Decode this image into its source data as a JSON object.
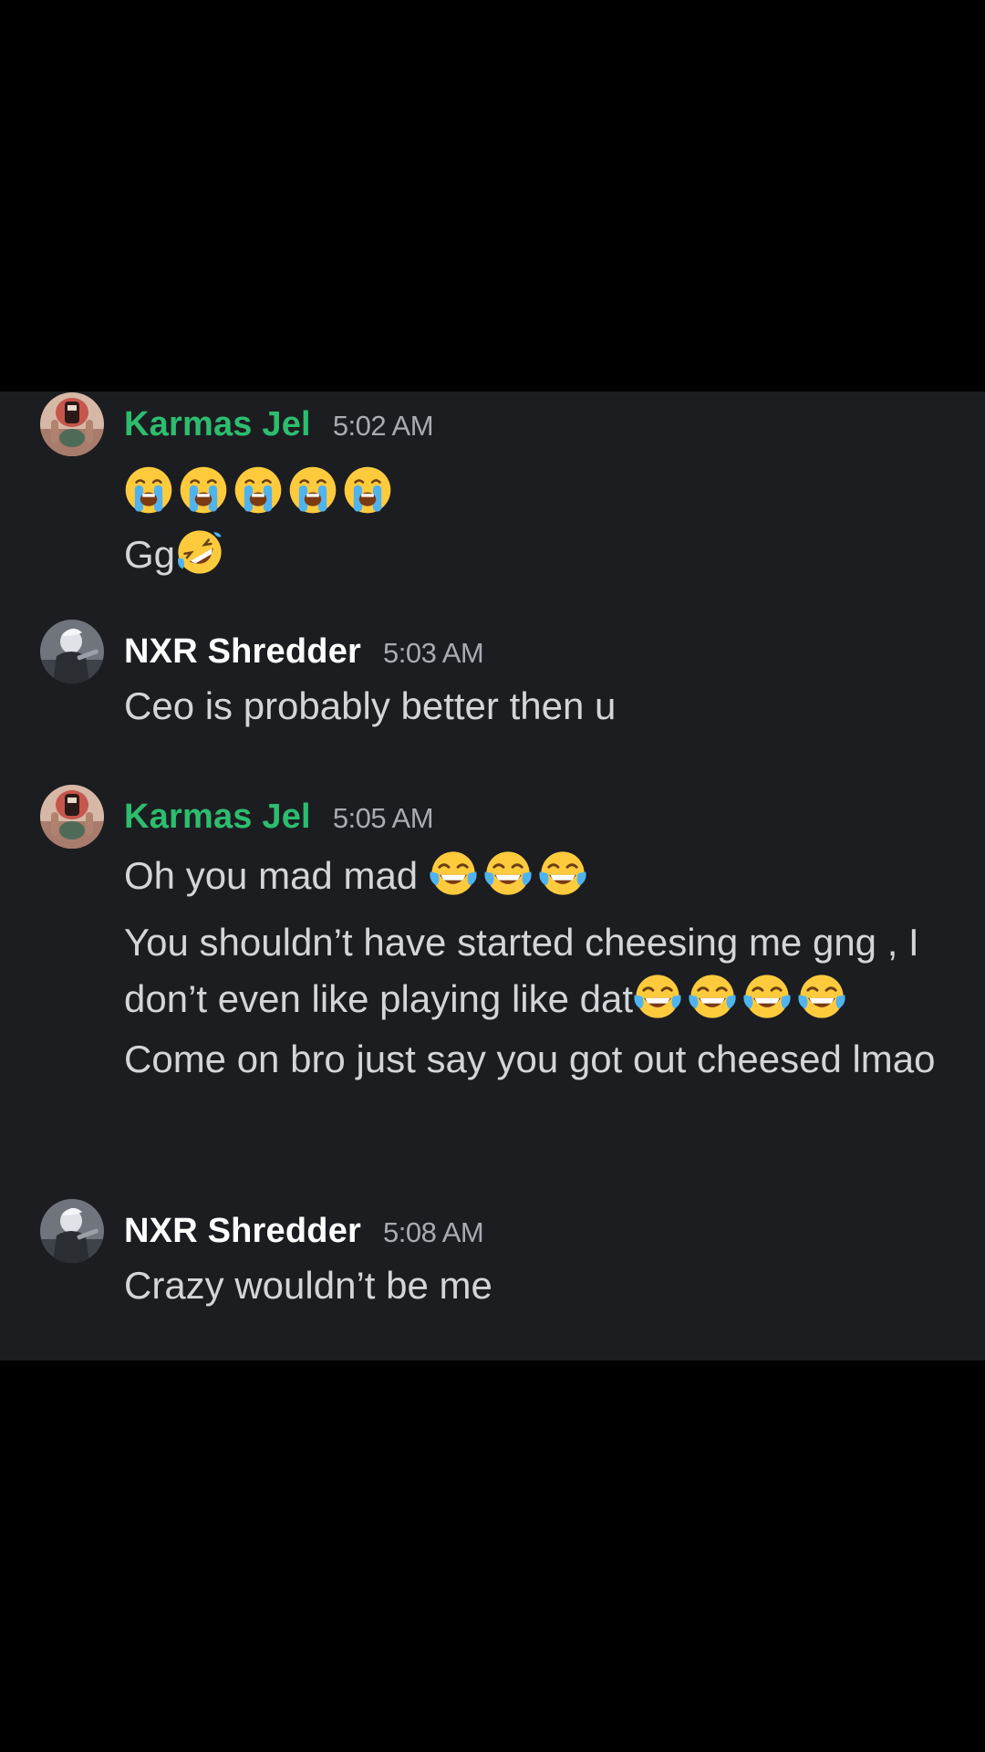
{
  "chat": {
    "messages": [
      {
        "author": "Karmas Jel",
        "author_color": "#2dbd6e",
        "time": "5:02 AM",
        "lines": [
          {
            "text": "",
            "emojis": [
              "loudly-crying-face",
              "loudly-crying-face",
              "loudly-crying-face",
              "loudly-crying-face",
              "loudly-crying-face"
            ]
          },
          {
            "text": "Gg",
            "emojis": [
              "rolling-on-floor-laughing"
            ]
          }
        ]
      },
      {
        "author": "NXR Shredder",
        "author_color": "#ffffff",
        "time": "5:03 AM",
        "lines": [
          {
            "text": "Ceo is probably better then u"
          }
        ]
      },
      {
        "author": "Karmas Jel",
        "author_color": "#2dbd6e",
        "time": "5:05 AM",
        "lines": [
          {
            "text": "Oh you mad mad ",
            "emojis": [
              "face-with-tears-of-joy",
              "face-with-tears-of-joy",
              "face-with-tears-of-joy"
            ]
          },
          {
            "text": "You shouldn’t have started cheesing me gng , I don’t even like playing like dat",
            "emojis": [
              "face-with-tears-of-joy",
              "face-with-tears-of-joy",
              "face-with-tears-of-joy",
              "face-with-tears-of-joy"
            ]
          },
          {
            "text": "Come on bro just say you got out cheesed lmao"
          }
        ]
      },
      {
        "author": "NXR Shredder",
        "author_color": "#ffffff",
        "time": "5:08 AM",
        "lines": [
          {
            "text": "Crazy wouldn’t be me"
          }
        ]
      }
    ]
  }
}
